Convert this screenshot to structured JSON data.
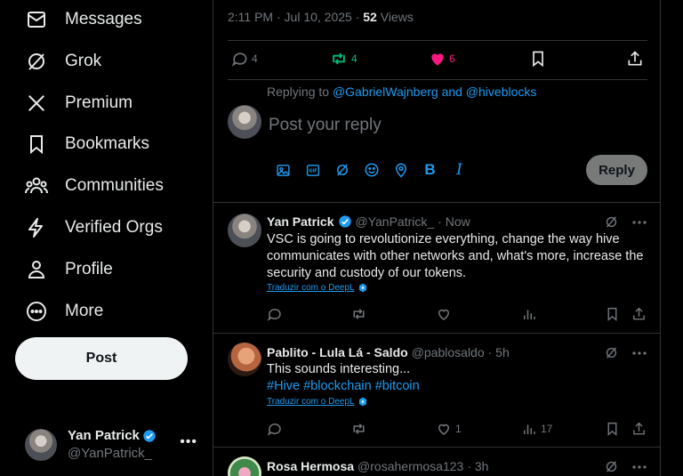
{
  "sidebar": {
    "items": [
      {
        "label": "Messages",
        "icon": "mail-icon"
      },
      {
        "label": "Grok",
        "icon": "grok-icon"
      },
      {
        "label": "Premium",
        "icon": "x-logo-icon"
      },
      {
        "label": "Bookmarks",
        "icon": "bookmark-icon"
      },
      {
        "label": "Communities",
        "icon": "communities-icon"
      },
      {
        "label": "Verified Orgs",
        "icon": "lightning-icon"
      },
      {
        "label": "Profile",
        "icon": "person-icon"
      },
      {
        "label": "More",
        "icon": "more-circle-icon"
      }
    ],
    "post_label": "Post",
    "account": {
      "name": "Yan Patrick",
      "handle": "@YanPatrick_",
      "more": "•••"
    }
  },
  "tweet": {
    "time": "2:11 PM · Jul 10, 2025 · ",
    "views_count": "52",
    "views_label": " Views",
    "replies": "4",
    "reposts": "4",
    "likes": "6"
  },
  "compose": {
    "replying_prefix": "Replying to ",
    "replying_users": "@GabrielWajnberg and @hiveblocks",
    "placeholder": "Post your reply",
    "reply_label": "Reply",
    "bold_label": "B",
    "italic_label": "I"
  },
  "replies": [
    {
      "name": "Yan Patrick",
      "verified": true,
      "handle": "@YanPatrick_",
      "time": "· Now",
      "text": "VSC is going to revolutionize everything, change the way hive communicates with other networks and, what's more, increase the security and custody of our tokens.",
      "tags": "",
      "translate": "Traduzir com o DeepL",
      "reply_count": "",
      "repost_count": "",
      "like_count": "",
      "view_count": ""
    },
    {
      "name": "Pablito - Lula Lá - Saldo",
      "verified": false,
      "handle": "@pablosaldo",
      "time": "· 5h",
      "text": "This sounds interesting...",
      "tags": "#Hive #blockchain #bitcoin",
      "translate": "Traduzir com o DeepL",
      "reply_count": "",
      "repost_count": "",
      "like_count": "1",
      "view_count": "17"
    },
    {
      "name": "Rosa Hermosa",
      "verified": false,
      "handle": "@rosahermosa123",
      "time": "· 3h"
    }
  ],
  "colors": {
    "accent": "#1d9bf0",
    "like": "#f91880",
    "repost": "#00ba7c",
    "muted": "#71767b"
  }
}
